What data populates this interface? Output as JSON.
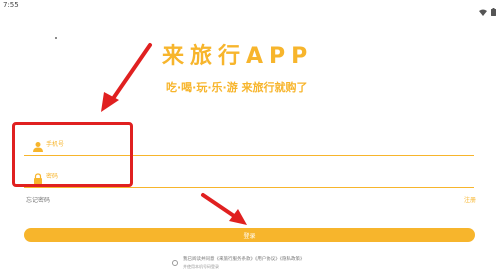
{
  "status_bar": {
    "time": "7:55",
    "icons": [
      "wifi-icon",
      "battery-icon"
    ]
  },
  "header": {
    "app_title": "来旅行APP",
    "slogan": "吃·喝·玩·乐·游 来旅行就购了"
  },
  "form": {
    "phone": {
      "placeholder": "手机号",
      "value": "",
      "icon": "user-icon"
    },
    "password": {
      "placeholder": "密码",
      "value": "",
      "icon": "lock-icon"
    },
    "forgot_label": "忘记密码",
    "register_label": "注册",
    "login_label": "登录"
  },
  "agreement": {
    "text": "我已阅读并同意《来旅行服务条款》《用户协议》《隐私政策》",
    "subtext": "并使用本机号码登录"
  },
  "colors": {
    "accent": "#F7B52C",
    "annotation": "#E02020"
  }
}
